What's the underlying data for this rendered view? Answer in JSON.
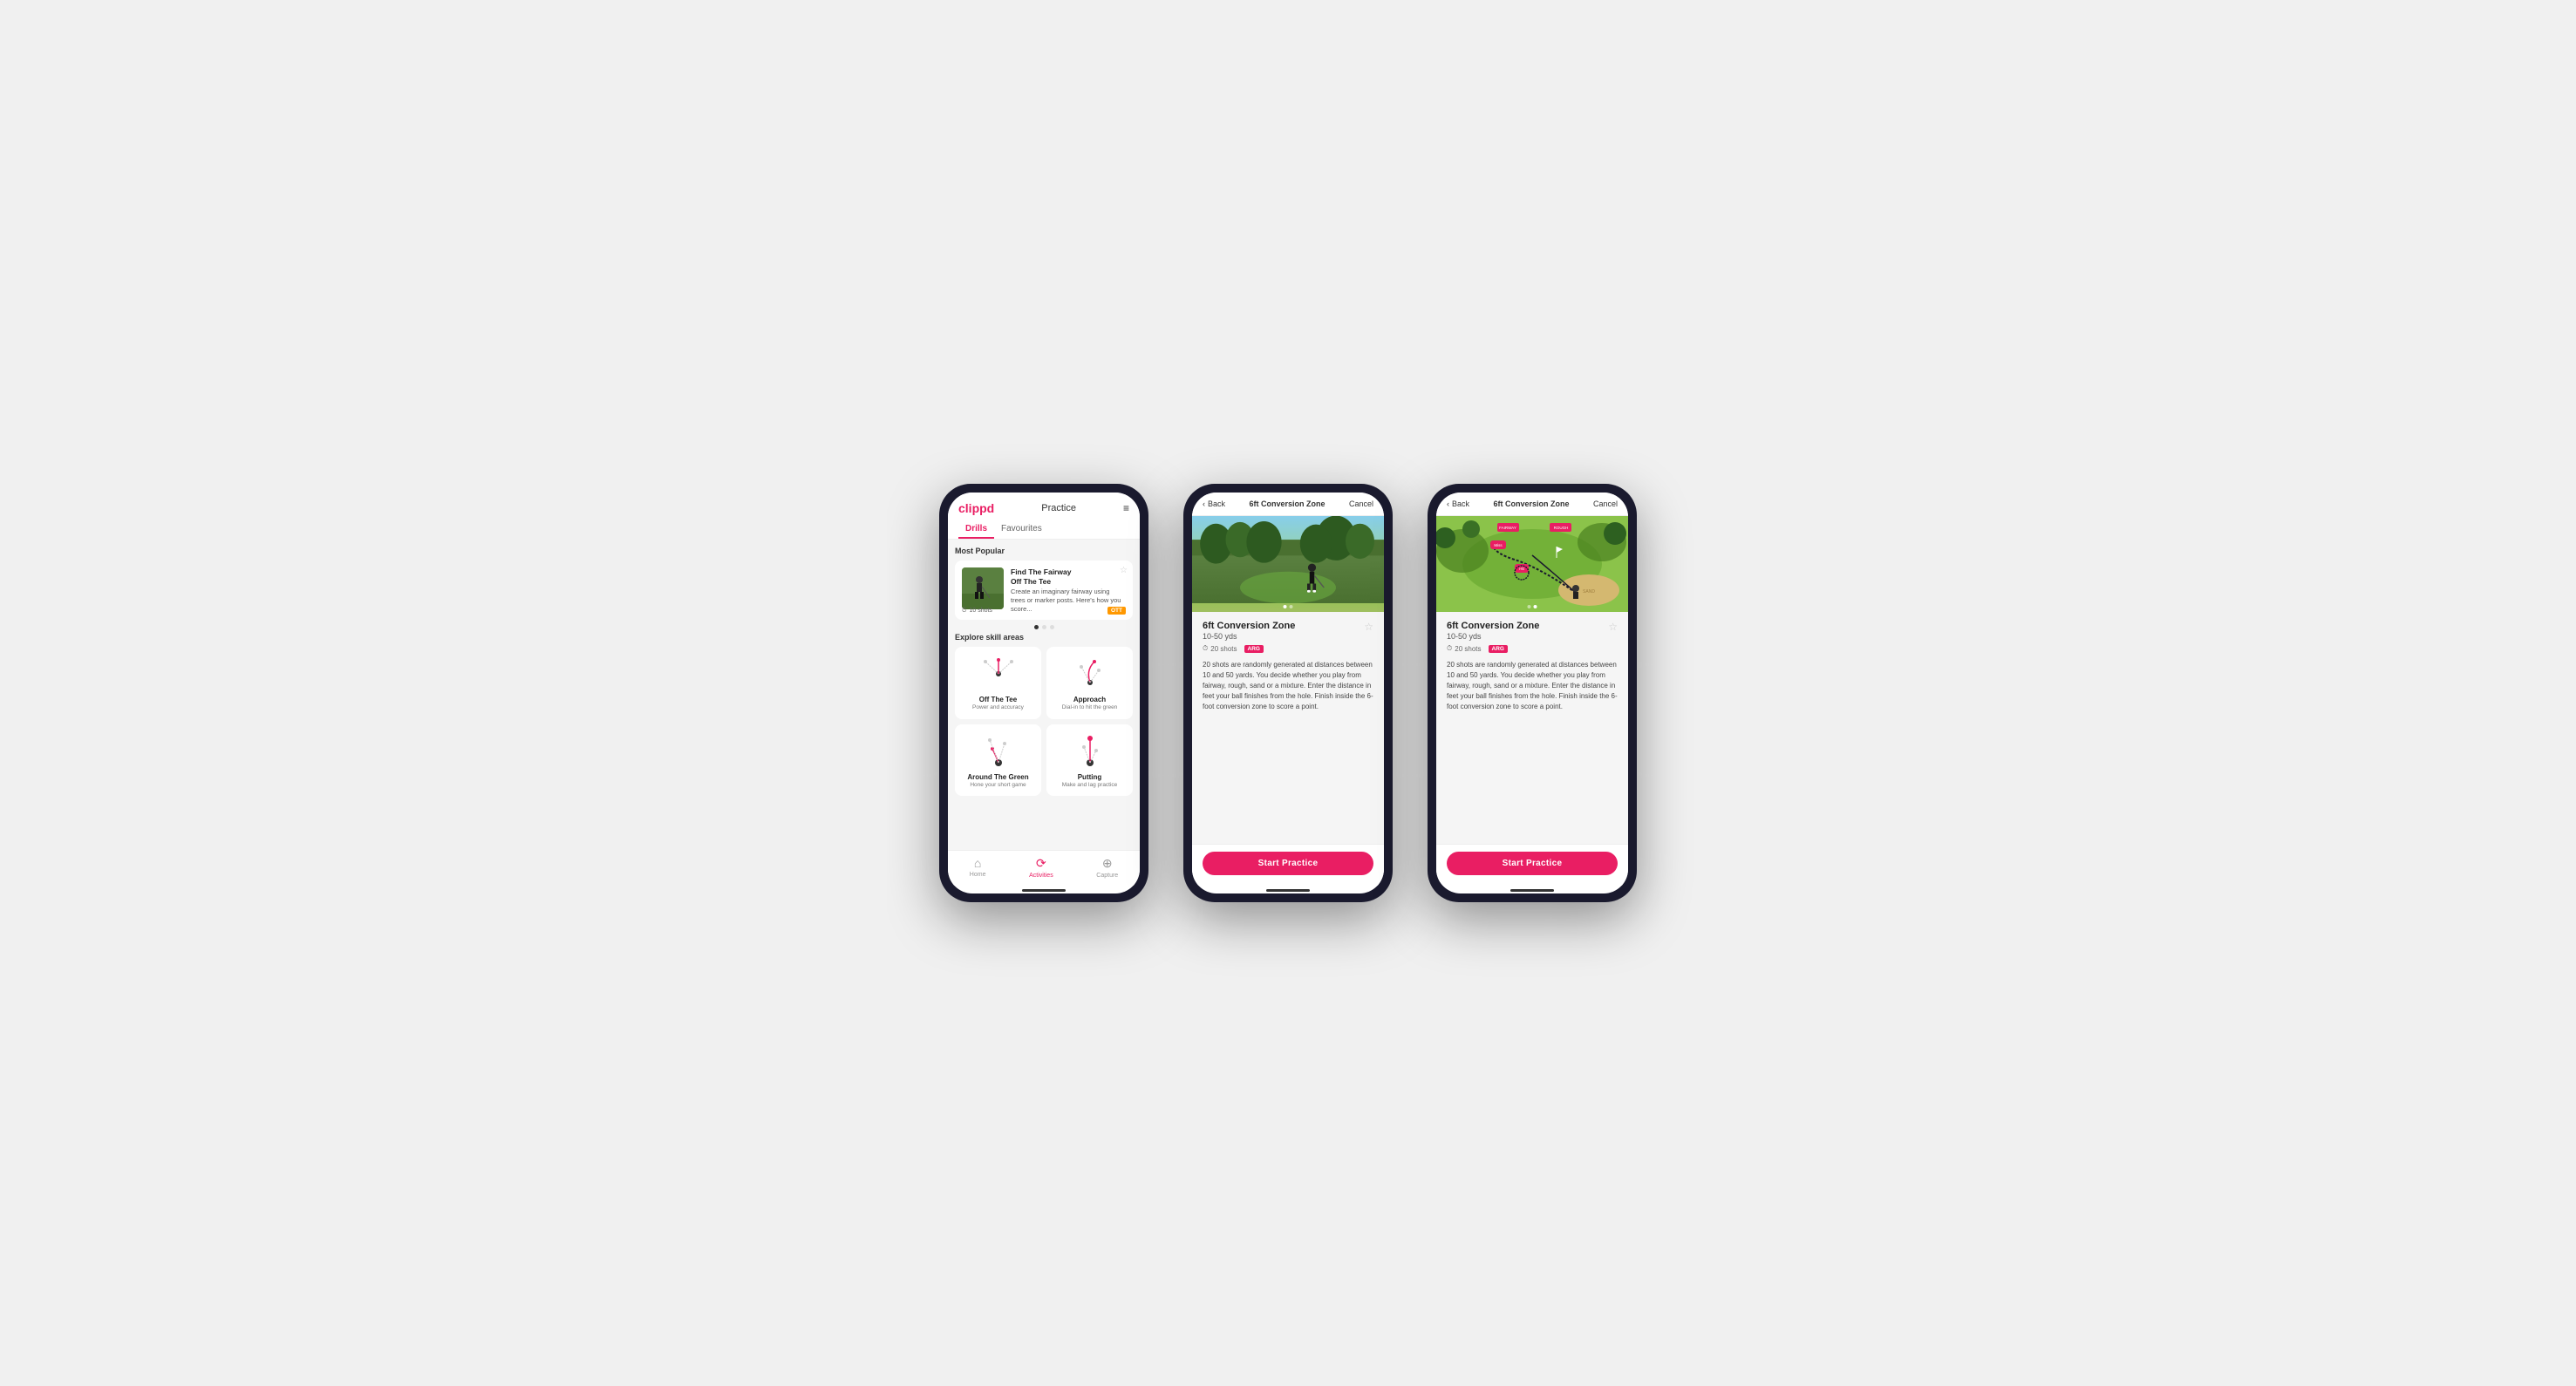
{
  "phones": [
    {
      "id": "phone1",
      "type": "practice-list",
      "header": {
        "logo": "clippd",
        "title": "Practice",
        "menu_icon": "≡"
      },
      "tabs": [
        {
          "label": "Drills",
          "active": true
        },
        {
          "label": "Favourites",
          "active": false
        }
      ],
      "most_popular_label": "Most Popular",
      "featured_drill": {
        "name": "Find The Fairway",
        "sub": "Off The Tee",
        "description": "Create an imaginary fairway using trees or marker posts. Here's how you score...",
        "shots": "10 shots",
        "tag": "OTT"
      },
      "explore_label": "Explore skill areas",
      "skill_areas": [
        {
          "name": "Off The Tee",
          "desc": "Power and accuracy",
          "icon": "ott"
        },
        {
          "name": "Approach",
          "desc": "Dial-in to hit the green",
          "icon": "approach"
        },
        {
          "name": "Around The Green",
          "desc": "Hone your short game",
          "icon": "atg"
        },
        {
          "name": "Putting",
          "desc": "Make and lag practice",
          "icon": "putting"
        }
      ],
      "bottom_nav": [
        {
          "label": "Home",
          "icon": "⌂",
          "active": false
        },
        {
          "label": "Activities",
          "icon": "⟳",
          "active": true
        },
        {
          "label": "Capture",
          "icon": "+",
          "active": false
        }
      ]
    },
    {
      "id": "phone2",
      "type": "drill-detail-photo",
      "header": {
        "back_label": "Back",
        "title": "6ft Conversion Zone",
        "cancel_label": "Cancel"
      },
      "drill": {
        "name": "6ft Conversion Zone",
        "range": "10-50 yds",
        "shots": "20 shots",
        "tag": "ARG",
        "description": "20 shots are randomly generated at distances between 10 and 50 yards. You decide whether you play from fairway, rough, sand or a mixture. Enter the distance in feet your ball finishes from the hole. Finish inside the 6-foot conversion zone to score a point."
      },
      "start_button": "Start Practice"
    },
    {
      "id": "phone3",
      "type": "drill-detail-map",
      "header": {
        "back_label": "Back",
        "title": "6ft Conversion Zone",
        "cancel_label": "Cancel"
      },
      "drill": {
        "name": "6ft Conversion Zone",
        "range": "10-50 yds",
        "shots": "20 shots",
        "tag": "ARG",
        "description": "20 shots are randomly generated at distances between 10 and 50 yards. You decide whether you play from fairway, rough, sand or a mixture. Enter the distance in feet your ball finishes from the hole. Finish inside the 6-foot conversion zone to score a point."
      },
      "start_button": "Start Practice"
    }
  ],
  "colors": {
    "brand_pink": "#e91e63",
    "tag_ott": "#ff9800",
    "tag_arg": "#e91e63",
    "dark_shell": "#1a1a2e"
  }
}
